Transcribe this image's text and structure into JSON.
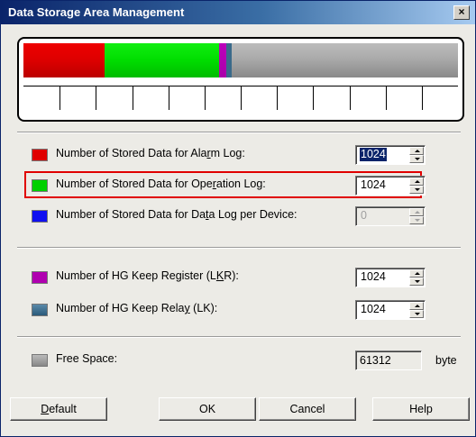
{
  "window": {
    "title": "Data Storage Area Management",
    "close_glyph": "×"
  },
  "bar": {
    "segments": [
      {
        "name": "alarm-log",
        "fraction": 0.1875,
        "color": "#e00000"
      },
      {
        "name": "operation-log",
        "fraction": 0.2625,
        "color": "#00d000"
      },
      {
        "name": "data-log",
        "fraction": 0.0,
        "color": "#2000c8"
      },
      {
        "name": "keep-register",
        "fraction": 0.0167,
        "color": "#b000b0"
      },
      {
        "name": "keep-relay",
        "fraction": 0.0125,
        "color": "#3a6a8a"
      },
      {
        "name": "free-space",
        "fraction": 0.52,
        "color": "#a8a8a8"
      }
    ],
    "tick_count": 11
  },
  "settings": {
    "alarm_log": {
      "label_pre": "Number of Stored Data for Ala",
      "label_mn": "r",
      "label_post": "m Log:",
      "value": "1024",
      "color": "#e00000"
    },
    "operation_log": {
      "label_pre": "Number of Stored Data for Ope",
      "label_mn": "r",
      "label_post": "ation Log:",
      "value": "1024",
      "color": "#00d000"
    },
    "data_log": {
      "label_pre": "Number of Stored Data for Da",
      "label_mn": "t",
      "label_post": "a Log per Device:",
      "value": "0",
      "color": "#1010f0"
    },
    "keep_register": {
      "label_pre": "Number of HG Keep Register (L",
      "label_mn": "K",
      "label_post": "R):",
      "value": "1024",
      "color": "#b000b0"
    },
    "keep_relay": {
      "label_pre": "Number of HG Keep Rela",
      "label_mn": "y",
      "label_post": " (LK):",
      "value": "1024",
      "color": "#3a6a8a"
    },
    "free_space": {
      "label": "Free Space:",
      "value": "61312",
      "unit": "byte",
      "color": "#a8a8a8"
    }
  },
  "buttons": {
    "default_mn": "D",
    "default_rest": "efault",
    "ok": "OK",
    "cancel": "Cancel",
    "help": "Help"
  }
}
